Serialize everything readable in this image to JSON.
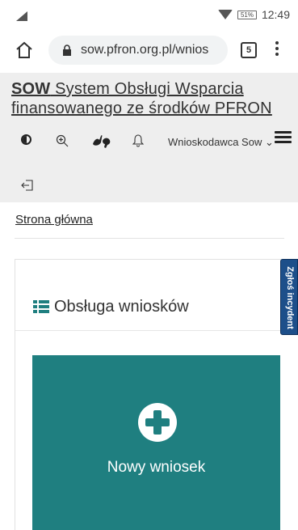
{
  "status_bar": {
    "time": "12:49",
    "battery": "51%"
  },
  "browser": {
    "url": "sow.pfron.org.pl/wnios",
    "tab_count": "5"
  },
  "header": {
    "title_bold": "SOW",
    "title_rest": " System Obsługi Wsparcia finansowanego ze środków PFRON",
    "user_name": "Wnioskodawca Sow",
    "icons": [
      "contrast-icon",
      "zoom-in-icon",
      "sign-language-icon",
      "bell-icon",
      "hamburger-menu-icon",
      "logout-icon"
    ]
  },
  "breadcrumb": {
    "home": "Strona główna"
  },
  "panel": {
    "title": "Obsługa wniosków",
    "new_application": "Nowy wniosek"
  },
  "side_tab": {
    "label": "Zgłoś incydent"
  },
  "colors": {
    "tile": "#1f7f80",
    "side_tab": "#1d4f8a",
    "header_bg": "#eeeeee"
  }
}
